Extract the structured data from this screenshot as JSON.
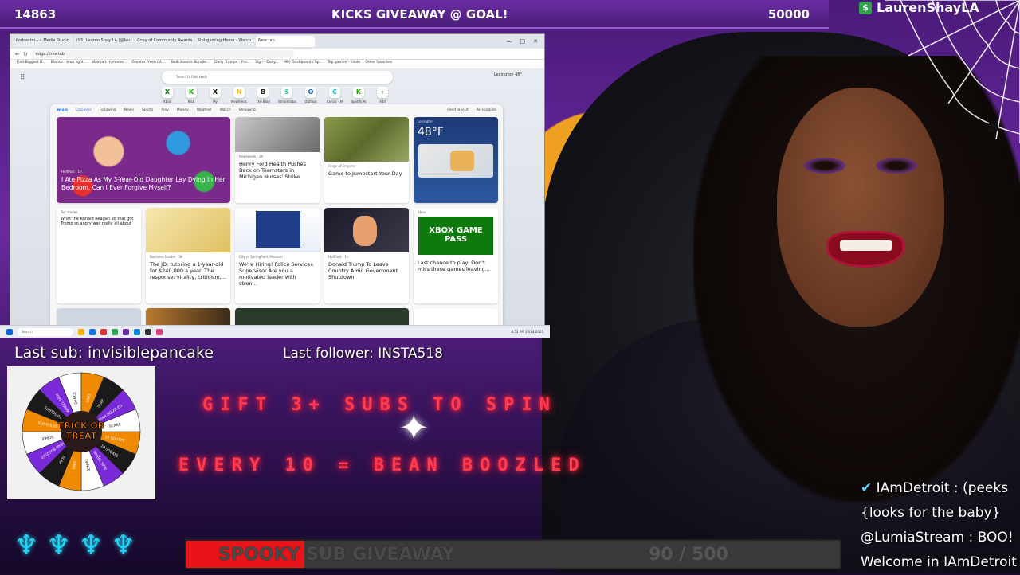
{
  "topbar": {
    "left_count": "14863",
    "center": "KICKS GIVEAWAY @ GOAL!",
    "right_count": "50000"
  },
  "streamer": {
    "name": "LaurenShayLA",
    "icon": "dollar-icon"
  },
  "browser": {
    "tabs": [
      "Podcaster - 4 Media Studio",
      "(95) Lauren Shay LA (@lau...",
      "Copy of Community Awards 202...",
      "Slot gaming Home - Watch Live...",
      "New tab"
    ],
    "url_hint": "edge://newtab",
    "bookmarks": [
      "Find Biggest D...",
      "Blanco - blue light...",
      "Walmart myhome...",
      "Greater Fresh LA ...",
      "Bulb Boards Bundle...",
      "Daily Tramps - Pro...",
      "Sign - Daily...",
      "(99) Dashboard / Sp...",
      "Top games - Kinde",
      "Other favorites"
    ],
    "search_placeholder": "Search the web",
    "weather_top": "Lexington  48°",
    "tiles": [
      {
        "label": "Xbox",
        "glyph": "X",
        "color": "#107c10"
      },
      {
        "label": "Kick",
        "glyph": "K",
        "color": "#53fc18"
      },
      {
        "label": "My Account",
        "glyph": "X",
        "color": "#000000"
      },
      {
        "label": "Newfeeds",
        "glyph": "N",
        "color": "#ffb400"
      },
      {
        "label": "The Bold LA",
        "glyph": "B",
        "color": "#222222"
      },
      {
        "label": "Streamlabs",
        "glyph": "S",
        "color": "#31c3a2"
      },
      {
        "label": "Outlook (free)",
        "glyph": "O",
        "color": "#0a64d8"
      },
      {
        "label": "Canva - AI",
        "glyph": "C",
        "color": "#00c4cc"
      },
      {
        "label": "Spotify AI",
        "glyph": "K",
        "color": "#53fc18"
      },
      {
        "label": "Add shortcut",
        "glyph": "+",
        "color": "#888888"
      }
    ],
    "msn_nav": [
      "msn",
      "Discover",
      "Following",
      "News",
      "Sports",
      "Play",
      "Money",
      "Weather",
      "Watch",
      "Shopping"
    ],
    "msn_buttons": [
      "Feed layout",
      "Personalize"
    ],
    "cards": [
      {
        "src": "HuffPost · 1h",
        "title": "I Ate Pizza As My 3-Year-Old Daughter Lay Dying In Her Bedroom. Can I Ever Forgive Myself?"
      },
      {
        "src": "Newsweek · 2h",
        "title": "Henry Ford Health Pushes Back on Teamsters in Michigan Nurses' Strike"
      },
      {
        "src": "Forge of Empires",
        "title": "Game to Jumpstart Your Day"
      },
      {
        "src": "Lexington",
        "title": "48°F"
      },
      {
        "src": "Top stories",
        "title": "What the Ronald Reagan ad that got Trump so angry was really all about"
      },
      {
        "src": "Business Insider · 3h",
        "title": "The JD: tutoring a 1-year-old for $240,000 a year. The response: virality, criticism,..."
      },
      {
        "src": "City of Springfield, Missouri",
        "title": "We're Hiring! Police Services Supervisor Are you a motivated leader with stron..."
      },
      {
        "src": "HuffPost · 1h",
        "title": "Donald Trump To Leave Country Amid Government Shutdown"
      },
      {
        "src": "Xbox",
        "title": "Last chance to play: Don't miss these games leaving..."
      }
    ],
    "xbox_logo": "XBOX GAME PASS",
    "taskbar_search": "Search",
    "clock": "8:52 PM 10/24/2025"
  },
  "overlay": {
    "last_sub": "Last sub: invisiblepancake",
    "last_follower": "Last follower: INSTA518",
    "neon_line1": "GIFT 3+ SUBS TO SPIN",
    "neon_line2": "EVERY 10 = BEAN BOOZLED",
    "wheel_center": "TRICK OR TREAT",
    "wheel_labels": [
      "10 SQUATS",
      "10 SQUATS",
      "WHEEL SPIN",
      "DANCE",
      "SING",
      "SLAP",
      "BEAN BOOZLED",
      "SCARE"
    ]
  },
  "goal": {
    "label": "SPOOKY SUB GIVEAWAY",
    "count": "90 / 500",
    "progress": 0.18,
    "fill_color": "#e8141a"
  },
  "chat": [
    {
      "icon": "check-icon",
      "text": "IAmDetroit : (peeks"
    },
    {
      "text": "{looks for the baby}"
    },
    {
      "text": "@LumiaStream : BOO!"
    },
    {
      "text": "Welcome in IAmDetroit"
    }
  ]
}
